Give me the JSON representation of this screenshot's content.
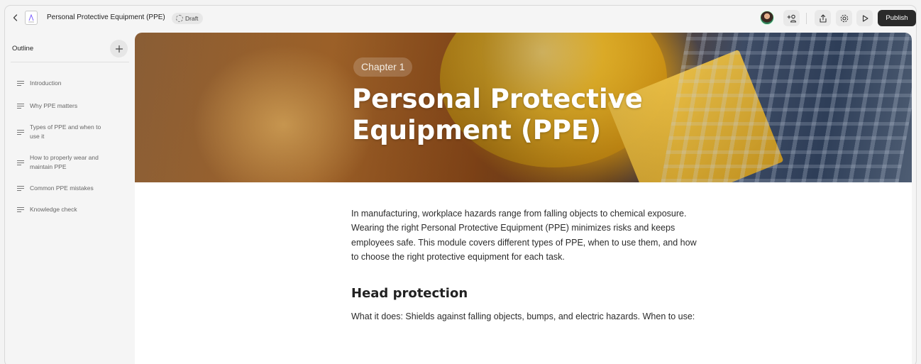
{
  "header": {
    "title": "Personal Protective Equipment (PPE)",
    "status": "Draft",
    "publish_label": "Publish"
  },
  "sidebar": {
    "title": "Outline",
    "items": [
      {
        "label": "Introduction"
      },
      {
        "label": "Why PPE matters"
      },
      {
        "label": "Types of PPE and when to use it"
      },
      {
        "label": "How to properly wear and maintain PPE"
      },
      {
        "label": "Common PPE mistakes"
      },
      {
        "label": "Knowledge check"
      }
    ]
  },
  "hero": {
    "chapter": "Chapter 1",
    "title": "Personal Protective Equipment (PPE)"
  },
  "content": {
    "intro": "In manufacturing, workplace hazards range from falling objects to chemical exposure. Wearing the right Personal Protective Equipment (PPE) minimizes risks and keeps employees safe. This module covers different types of PPE, when to use them, and how to choose the right protective equipment for each task.",
    "section_title": "Head protection",
    "section_text": "What it does: Shields against falling objects, bumps, and electric hazards. When to use:"
  },
  "icons": {
    "back": "chevron-left-icon",
    "doc": "document-icon",
    "draft": "dashed-circle-icon",
    "invite": "add-user-icon",
    "share": "share-icon",
    "settings": "gear-icon",
    "preview": "play-icon",
    "add": "plus-icon",
    "outline_item": "text-lines-icon"
  },
  "colors": {
    "publish_bg": "#2a2a2a",
    "sidebar_bg": "#f5f5f5",
    "content_bg": "#ffffff",
    "helmet": "#f4c02c"
  }
}
